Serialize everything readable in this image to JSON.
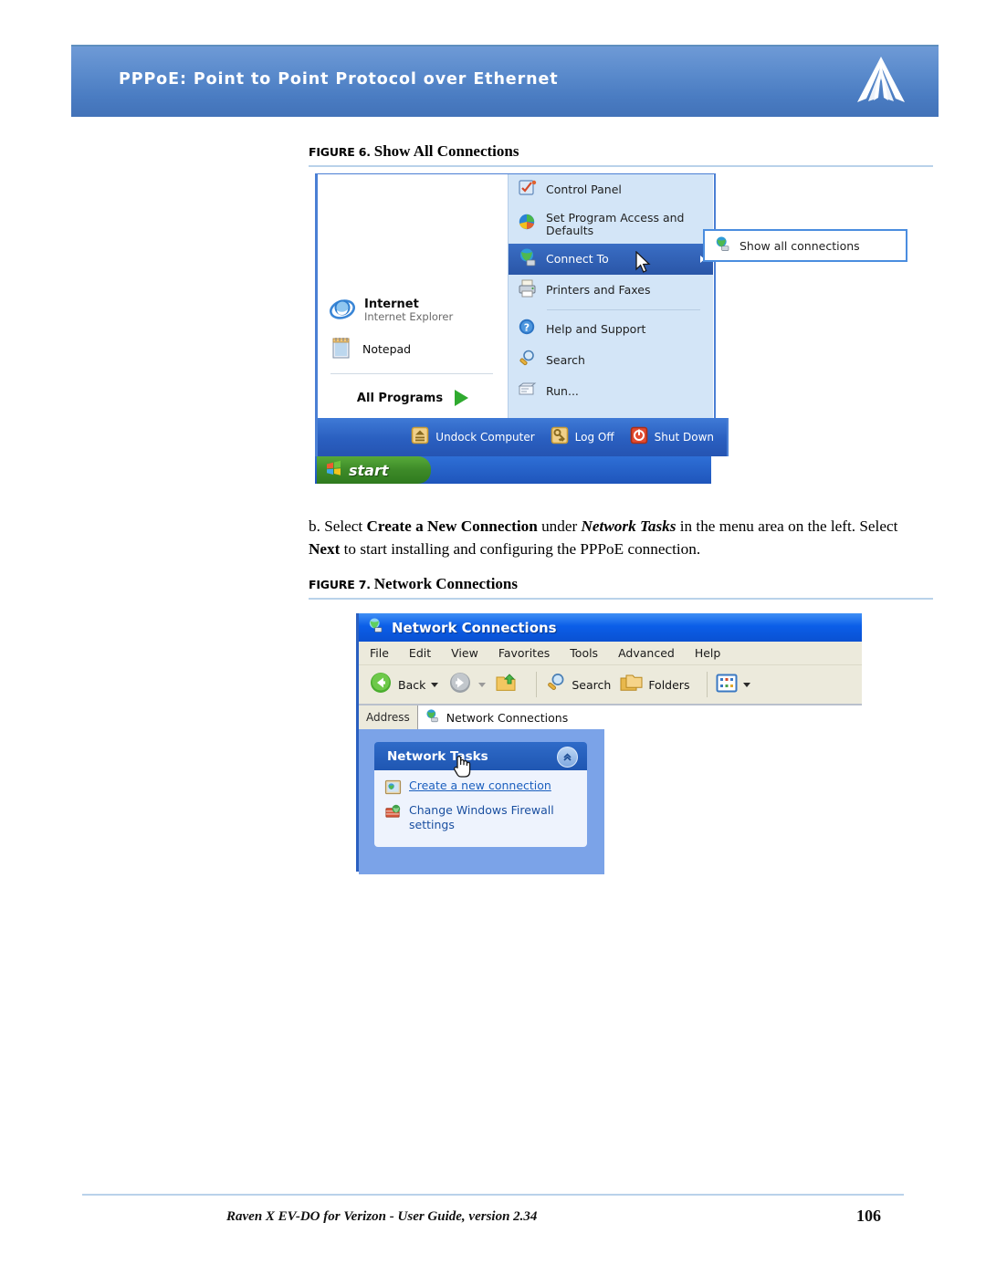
{
  "header": {
    "title": "PPPoE: Point to Point Protocol over Ethernet",
    "logo_icon": "sierra-wireless-triangle-logo",
    "band_color_top": "#6e9ad6",
    "band_color_bottom": "#4272b8"
  },
  "figure6": {
    "caption_prefix": "FIGURE 6.",
    "caption_text": "Show All Connections",
    "start_menu": {
      "left_items": [
        {
          "title": "Internet",
          "subtitle": "Internet Explorer",
          "icon": "internet-explorer-icon"
        },
        {
          "title": "Notepad",
          "subtitle": "",
          "icon": "notepad-icon"
        }
      ],
      "all_programs_label": "All Programs",
      "all_programs_icon": "green-arrow-icon",
      "right_items": [
        {
          "label": "Control Panel",
          "icon": "control-panel-icon",
          "selected": false,
          "submenu": false
        },
        {
          "label": "Set Program Access and Defaults",
          "icon": "set-program-access-icon",
          "selected": false,
          "submenu": false
        },
        {
          "label": "Connect To",
          "icon": "connect-to-globe-icon",
          "selected": true,
          "submenu": true
        },
        {
          "label": "Printers and Faxes",
          "icon": "printer-icon",
          "selected": false,
          "submenu": false
        },
        {
          "label": "Help and Support",
          "icon": "help-question-icon",
          "selected": false,
          "submenu": false
        },
        {
          "label": "Search",
          "icon": "search-magnifier-icon",
          "selected": false,
          "submenu": false
        },
        {
          "label": "Run...",
          "icon": "run-icon",
          "selected": false,
          "submenu": false
        }
      ],
      "footer_items": [
        {
          "label": "Undock Computer",
          "icon": "undock-eject-icon"
        },
        {
          "label": "Log Off",
          "icon": "log-off-key-icon"
        },
        {
          "label": "Shut Down",
          "icon": "shut-down-power-icon"
        }
      ],
      "start_button_label": "start",
      "start_button_icon": "windows-flag-icon",
      "submenu": {
        "label": "Show all connections",
        "icon": "network-connections-globe-icon"
      }
    }
  },
  "paragraph_b": {
    "segment_1": "b. Select ",
    "bold_1": "Create a New Connection",
    "segment_2": " under ",
    "italic_1": "Network Tasks",
    "segment_3": " in the menu area on the left. Select ",
    "bold_2": "Next",
    "segment_4": " to start installing and configuring the PPPoE connection."
  },
  "figure7": {
    "caption_prefix": "FIGURE 7.",
    "caption_text": "Network Connections",
    "window": {
      "title": "Network Connections",
      "title_icon": "network-connections-globe-icon",
      "menu_items": [
        "File",
        "Edit",
        "View",
        "Favorites",
        "Tools",
        "Advanced",
        "Help"
      ],
      "toolbar": {
        "back_label": "Back",
        "back_icon": "back-arrow-icon",
        "forward_icon": "forward-arrow-icon",
        "up_icon": "up-folder-icon",
        "search_label": "Search",
        "search_icon": "search-magnifier-icon",
        "folders_label": "Folders",
        "folders_icon": "folders-icon",
        "views_icon": "views-icon"
      },
      "address": {
        "label": "Address",
        "value": "Network Connections",
        "icon": "network-connections-globe-icon"
      },
      "network_tasks": {
        "header": "Network Tasks",
        "collapse_icon": "chevron-up-icon",
        "items": [
          {
            "label": "Create a new connection",
            "icon": "new-connection-icon",
            "is_link": true
          },
          {
            "label": "Change Windows Firewall settings",
            "icon": "firewall-shield-icon",
            "is_link": false
          }
        ]
      }
    }
  },
  "footer": {
    "document_title": "Raven X EV-DO for Verizon - User Guide, version 2.34",
    "page_number": "106"
  }
}
